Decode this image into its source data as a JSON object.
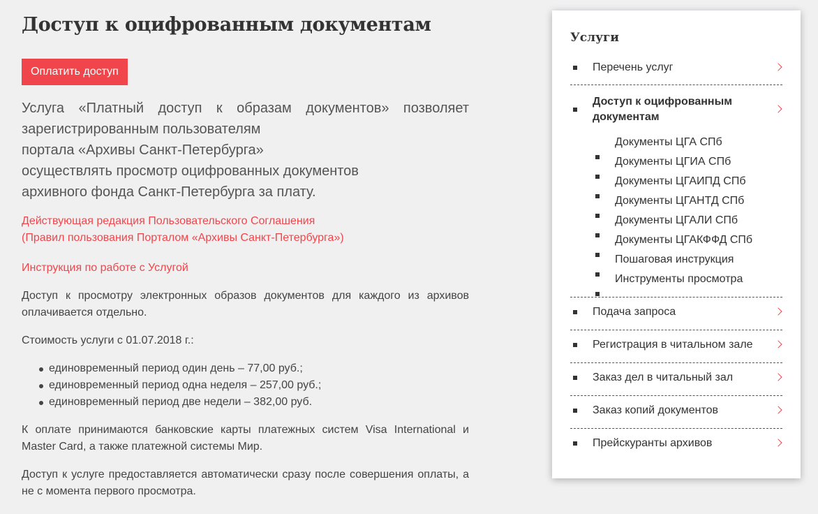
{
  "main": {
    "title": "Доступ к оцифрованным документам",
    "pay_button": "Оплатить доступ",
    "intro": {
      "line1": "Услуга «Платный доступ к образам документов» позволяет",
      "line2": "зарегистрированным пользователям",
      "line3": "портала «Архивы Санкт-Петербурга»",
      "line4": "осуществлять просмотр оцифрованных документов",
      "line5": "архивного фонда Санкт-Петербурга за плату."
    },
    "agreement_link_line1": "Действующая редакция Пользовательского Соглашения",
    "agreement_link_line2": "(Правил пользования Порталом «Архивы Санкт-Петербурга»)",
    "instruction_link": "Инструкция по работе с Услугой",
    "p_access": "Доступ к просмотру электронных образов документов для каждого из архивов оплачивается отдельно.",
    "p_cost": "Стоимость услуги с 01.07.2018 г.:",
    "prices": [
      "единовременный период один день – 77,00 руб.;",
      "единовременный период одна неделя – 257,00 руб.;",
      "единовременный период две недели – 382,00 руб."
    ],
    "p_cards": "К оплате принимаются банковские карты платежных систем Visa International и Master Card, а также платежной системы Мир.",
    "p_auto": "Доступ к услуге предоставляется автоматически сразу после совершения оплаты, а не с момента первого просмотра."
  },
  "sidebar": {
    "title": "Услуги",
    "items": [
      {
        "label": "Перечень услуг"
      },
      {
        "label": "Доступ к оцифрованным документам"
      },
      {
        "label": "Подача запроса"
      },
      {
        "label": "Регистрация в читальном зале"
      },
      {
        "label": "Заказ дел в читальный зал"
      },
      {
        "label": "Заказ копий документов"
      },
      {
        "label": "Прейскуранты архивов"
      }
    ],
    "subitems": [
      "Документы ЦГА СПб",
      "Документы ЦГИА СПб",
      "Документы ЦГАИПД СПб",
      "Документы ЦГАНТД СПб",
      "Документы ЦГАЛИ СПб",
      "Документы ЦГАКФФД СПб",
      "Пошаговая инструкция",
      "Инструменты просмотра"
    ]
  },
  "colors": {
    "accent": "#f0464b",
    "background": "#f0f0f1",
    "text": "#333333"
  },
  "icons": {
    "chevron": "chevron-right-icon",
    "bullet": "square-bullet-icon"
  }
}
